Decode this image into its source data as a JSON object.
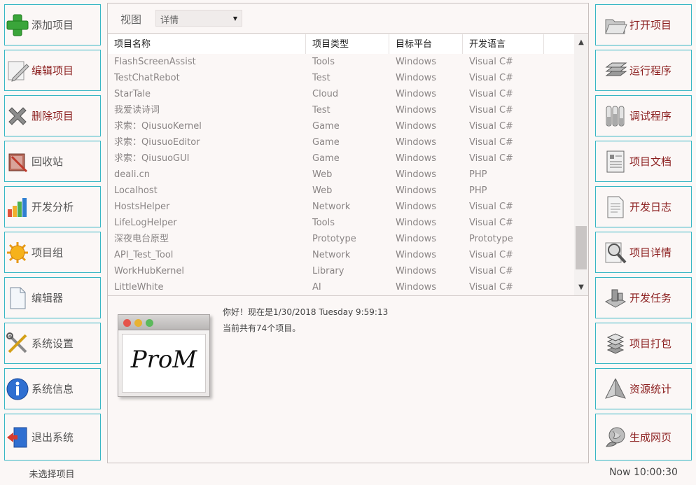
{
  "left_buttons": [
    {
      "label": "添加项目",
      "icon": "plus-icon"
    },
    {
      "label": "编辑项目",
      "icon": "pencil-icon"
    },
    {
      "label": "删除项目",
      "icon": "delete-x-icon"
    },
    {
      "label": "回收站",
      "icon": "recycle-bin-icon"
    },
    {
      "label": "开发分析",
      "icon": "bar-chart-icon"
    },
    {
      "label": "项目组",
      "icon": "sun-icon"
    },
    {
      "label": "编辑器",
      "icon": "document-icon"
    },
    {
      "label": "系统设置",
      "icon": "tools-icon"
    },
    {
      "label": "系统信息",
      "icon": "info-icon"
    },
    {
      "label": "退出系统",
      "icon": "exit-door-icon"
    }
  ],
  "right_buttons": [
    {
      "label": "打开项目",
      "icon": "open-folder-icon"
    },
    {
      "label": "运行程序",
      "icon": "run-stack-icon"
    },
    {
      "label": "调试程序",
      "icon": "test-tubes-icon"
    },
    {
      "label": "项目文档",
      "icon": "project-doc-icon"
    },
    {
      "label": "开发日志",
      "icon": "log-icon"
    },
    {
      "label": "项目详情",
      "icon": "magnifier-icon"
    },
    {
      "label": "开发任务",
      "icon": "task-blocks-icon"
    },
    {
      "label": "项目打包",
      "icon": "package-icon"
    },
    {
      "label": "资源统计",
      "icon": "pyramid-icon"
    },
    {
      "label": "生成网页",
      "icon": "web-globe-icon"
    }
  ],
  "toolbar": {
    "view_label": "视图",
    "view_value": "详情"
  },
  "list": {
    "columns": [
      "项目名称",
      "项目类型",
      "目标平台",
      "开发语言"
    ],
    "rows": [
      [
        "FlashScreenAssist",
        "Tools",
        "Windows",
        "Visual C#"
      ],
      [
        "TestChatRebot",
        "Test",
        "Windows",
        "Visual C#"
      ],
      [
        "StarTale",
        "Cloud",
        "Windows",
        "Visual C#"
      ],
      [
        "我爱读诗词",
        "Test",
        "Windows",
        "Visual C#"
      ],
      [
        "求索：QiusuoKernel",
        "Game",
        "Windows",
        "Visual C#"
      ],
      [
        "求索：QiusuoEditor",
        "Game",
        "Windows",
        "Visual C#"
      ],
      [
        "求索：QiusuoGUI",
        "Game",
        "Windows",
        "Visual C#"
      ],
      [
        "deali.cn",
        "Web",
        "Windows",
        "PHP"
      ],
      [
        "Localhost",
        "Web",
        "Windows",
        "PHP"
      ],
      [
        "HostsHelper",
        "Network",
        "Windows",
        "Visual C#"
      ],
      [
        "LifeLogHelper",
        "Tools",
        "Windows",
        "Visual C#"
      ],
      [
        "深夜电台原型",
        "Prototype",
        "Windows",
        "Prototype"
      ],
      [
        "API_Test_Tool",
        "Network",
        "Windows",
        "Visual C#"
      ],
      [
        "WorkHubKernel",
        "Library",
        "Windows",
        "Visual C#"
      ],
      [
        "LittleWhite",
        "AI",
        "Windows",
        "Visual C#"
      ]
    ]
  },
  "info": {
    "logo_text": "ProM",
    "greeting": "你好！现在是1/30/2018 Tuesday 9:59:13",
    "count_text": "当前共有74个项目。"
  },
  "status": {
    "left": "未选择项目",
    "right": "Now 10:00:30"
  },
  "colors": {
    "button_border": "#38b6c4",
    "right_label": "#8b1e1e",
    "background": "#fbf7f6"
  }
}
